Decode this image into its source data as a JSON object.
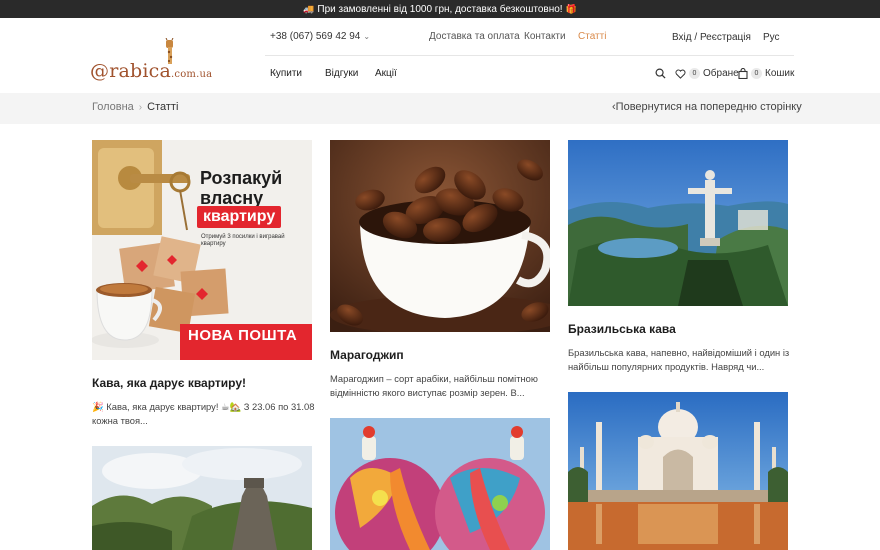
{
  "promo": {
    "text": "При замовленні від 1000 грн, доставка безкоштовно!",
    "icon_left": "truck-icon",
    "icon_right": "gift-icon"
  },
  "logo": {
    "text": "@rabica",
    "domain": ".com.ua",
    "icon": "giraffe-icon"
  },
  "header": {
    "phone": "+38 (067) 569 42 94",
    "top_links": [
      "Доставка та оплата",
      "Контакти",
      "Статті"
    ],
    "login": "Вхід / Реєстрація",
    "language": "Рус",
    "nav": [
      "Купити",
      "Відгуки",
      "Акції"
    ],
    "favorites": {
      "label": "Обране",
      "count": "0"
    },
    "cart": {
      "label": "Кошик",
      "count": "0"
    }
  },
  "breadcrumbs": {
    "home": "Головна",
    "current": "Статті",
    "back": "Повернутися на попередню сторінку"
  },
  "articles": [
    {
      "title": "Кава, яка дарує квартиру!",
      "excerpt_line1": "🎉 Кава, яка дарує квартиру! ☕🏡 З 23.06 по 31.08",
      "excerpt_line2": "кожна твоя...",
      "banner": {
        "headline1": "Розпакуй",
        "headline2": "власну",
        "headline3": "квартиру",
        "sub1": "Отримуй 3 посилки і вигравай",
        "sub2": "квартиру",
        "brand": "НОВА ПОШТА"
      }
    },
    {
      "title": "Марагоджип",
      "excerpt_line1": "Марагоджип – сорт арабіки, найбільш помітною",
      "excerpt_line2": "відмінністю якого виступає розмір зерен. В..."
    },
    {
      "title": "Бразильська кава",
      "excerpt_line1": "Бразильська кава, напевно, найвідоміший і один із",
      "excerpt_line2": "найбільш популярних продуктів. Навряд чи..."
    }
  ],
  "colors": {
    "accent": "#d98a4a",
    "logo": "#a0522d",
    "nova_poshta_red": "#e3262e",
    "promo_bg": "#2a2a2a"
  }
}
